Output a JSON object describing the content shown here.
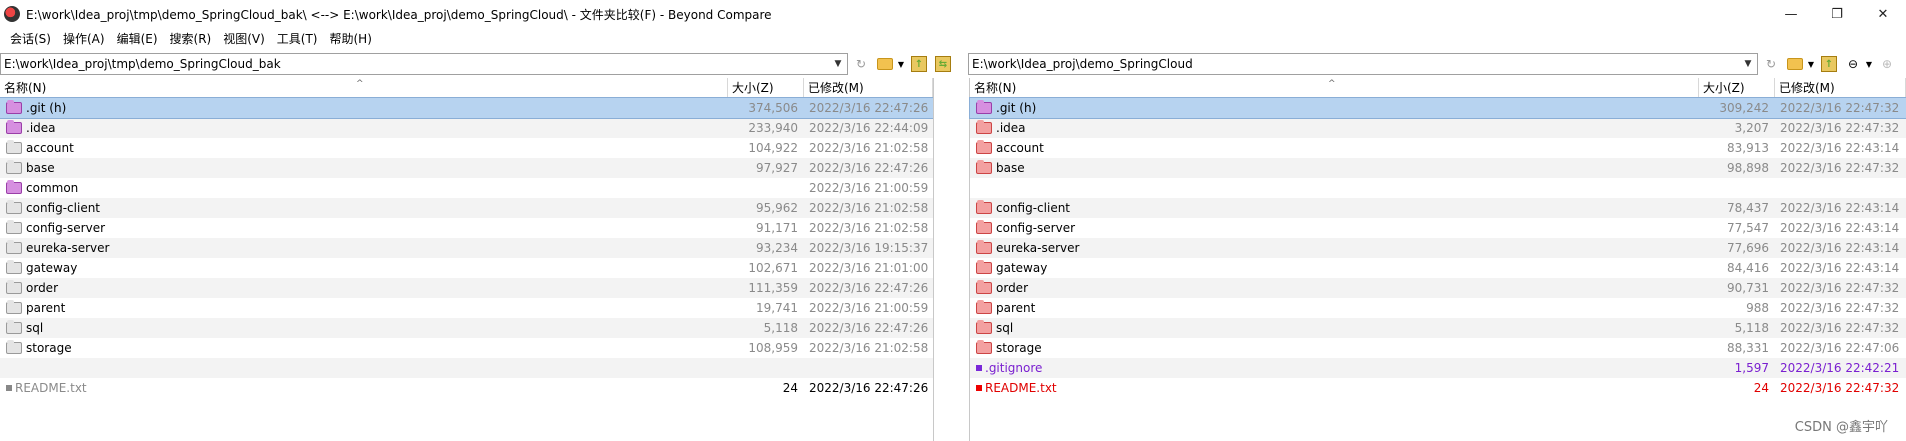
{
  "window": {
    "title": "E:\\work\\Idea_proj\\tmp\\demo_SpringCloud_bak\\ <--> E:\\work\\Idea_proj\\demo_SpringCloud\\ - 文件夹比较(F) - Beyond Compare",
    "minimize": "—",
    "restore": "❐",
    "close": "✕"
  },
  "menu": [
    "会话(S)",
    "操作(A)",
    "编辑(E)",
    "搜索(R)",
    "视图(V)",
    "工具(T)",
    "帮助(H)"
  ],
  "left": {
    "path": "E:\\work\\Idea_proj\\tmp\\demo_SpringCloud_bak",
    "columns": {
      "name": "名称(N)",
      "size": "大小(Z)",
      "modified": "已修改(M)"
    },
    "rows": [
      {
        "name": ".git (h)",
        "size": "374,506",
        "date": "2022/3/16 22:47:26",
        "icon": "folder-purple",
        "color": "gray",
        "selected": true
      },
      {
        "name": ".idea",
        "size": "233,940",
        "date": "2022/3/16 22:44:09",
        "icon": "folder-purple",
        "color": "gray"
      },
      {
        "name": "account",
        "size": "104,922",
        "date": "2022/3/16 21:02:58",
        "icon": "folder-gray",
        "color": "gray"
      },
      {
        "name": "base",
        "size": "97,927",
        "date": "2022/3/16 22:47:26",
        "icon": "folder-gray",
        "color": "gray"
      },
      {
        "name": "common",
        "size": "",
        "date": "2022/3/16 21:00:59",
        "icon": "folder-purple",
        "color": "gray"
      },
      {
        "name": "config-client",
        "size": "95,962",
        "date": "2022/3/16 21:02:58",
        "icon": "folder-gray",
        "color": "gray"
      },
      {
        "name": "config-server",
        "size": "91,171",
        "date": "2022/3/16 21:02:58",
        "icon": "folder-gray",
        "color": "gray"
      },
      {
        "name": "eureka-server",
        "size": "93,234",
        "date": "2022/3/16 19:15:37",
        "icon": "folder-gray",
        "color": "gray"
      },
      {
        "name": "gateway",
        "size": "102,671",
        "date": "2022/3/16 21:01:00",
        "icon": "folder-gray",
        "color": "gray"
      },
      {
        "name": "order",
        "size": "111,359",
        "date": "2022/3/16 22:47:26",
        "icon": "folder-gray",
        "color": "gray"
      },
      {
        "name": "parent",
        "size": "19,741",
        "date": "2022/3/16 21:00:59",
        "icon": "folder-gray",
        "color": "gray"
      },
      {
        "name": "sql",
        "size": "5,118",
        "date": "2022/3/16 22:47:26",
        "icon": "folder-gray",
        "color": "gray"
      },
      {
        "name": "storage",
        "size": "108,959",
        "date": "2022/3/16 21:02:58",
        "icon": "folder-gray",
        "color": "gray"
      },
      {
        "name": "",
        "size": "",
        "date": "",
        "icon": "none",
        "color": "gray"
      },
      {
        "name": "README.txt",
        "size": "24",
        "date": "2022/3/16 22:47:26",
        "icon": "file-gray",
        "color": "gray"
      }
    ]
  },
  "right": {
    "path": "E:\\work\\Idea_proj\\demo_SpringCloud",
    "columns": {
      "name": "名称(N)",
      "size": "大小(Z)",
      "modified": "已修改(M)"
    },
    "rows": [
      {
        "name": ".git (h)",
        "size": "309,242",
        "date": "2022/3/16 22:47:32",
        "icon": "folder-purple",
        "color": "gray",
        "selected": true
      },
      {
        "name": ".idea",
        "size": "3,207",
        "date": "2022/3/16 22:47:32",
        "icon": "folder-red",
        "color": "gray"
      },
      {
        "name": "account",
        "size": "83,913",
        "date": "2022/3/16 22:43:14",
        "icon": "folder-red",
        "color": "gray"
      },
      {
        "name": "base",
        "size": "98,898",
        "date": "2022/3/16 22:47:32",
        "icon": "folder-red",
        "color": "gray"
      },
      {
        "name": "",
        "size": "",
        "date": "",
        "icon": "none",
        "color": "gray"
      },
      {
        "name": "config-client",
        "size": "78,437",
        "date": "2022/3/16 22:43:14",
        "icon": "folder-red",
        "color": "gray"
      },
      {
        "name": "config-server",
        "size": "77,547",
        "date": "2022/3/16 22:43:14",
        "icon": "folder-red",
        "color": "gray"
      },
      {
        "name": "eureka-server",
        "size": "77,696",
        "date": "2022/3/16 22:43:14",
        "icon": "folder-red",
        "color": "gray"
      },
      {
        "name": "gateway",
        "size": "84,416",
        "date": "2022/3/16 22:43:14",
        "icon": "folder-red",
        "color": "gray"
      },
      {
        "name": "order",
        "size": "90,731",
        "date": "2022/3/16 22:47:32",
        "icon": "folder-red",
        "color": "gray"
      },
      {
        "name": "parent",
        "size": "988",
        "date": "2022/3/16 22:47:32",
        "icon": "folder-red",
        "color": "gray"
      },
      {
        "name": "sql",
        "size": "5,118",
        "date": "2022/3/16 22:47:32",
        "icon": "folder-red",
        "color": "gray"
      },
      {
        "name": "storage",
        "size": "88,331",
        "date": "2022/3/16 22:47:06",
        "icon": "folder-red",
        "color": "gray"
      },
      {
        "name": ".gitignore",
        "size": "1,597",
        "date": "2022/3/16 22:42:21",
        "icon": "file-purple",
        "color": "purple"
      },
      {
        "name": "README.txt",
        "size": "24",
        "date": "2022/3/16 22:47:32",
        "icon": "file-red",
        "color": "red"
      }
    ]
  },
  "watermark": "CSDN @鑫宇吖",
  "colors": {
    "selected_row": "#b7d3f0",
    "orphan_purple": "#7a1fd0",
    "diff_red": "#e00000",
    "same_gray": "#8a8a8a"
  }
}
